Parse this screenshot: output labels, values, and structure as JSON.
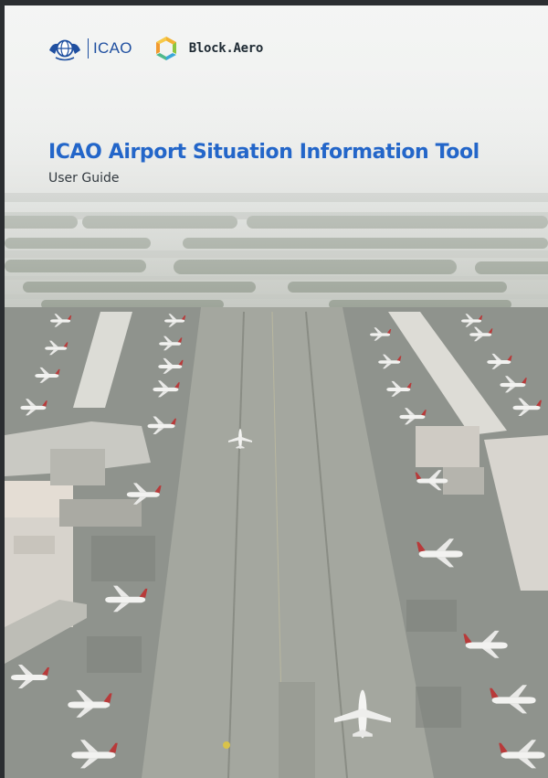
{
  "cover": {
    "logos": {
      "icao_label": "ICAO",
      "partner_label": "Block.Aero"
    },
    "title": "ICAO Airport Situation Information Tool",
    "subtitle": "User Guide",
    "icons": [
      "icao-emblem-icon",
      "block-aero-logo-icon"
    ],
    "colors": {
      "title": "#2366c9",
      "icao_blue": "#1f4fa0",
      "subtitle": "#333a40"
    }
  }
}
